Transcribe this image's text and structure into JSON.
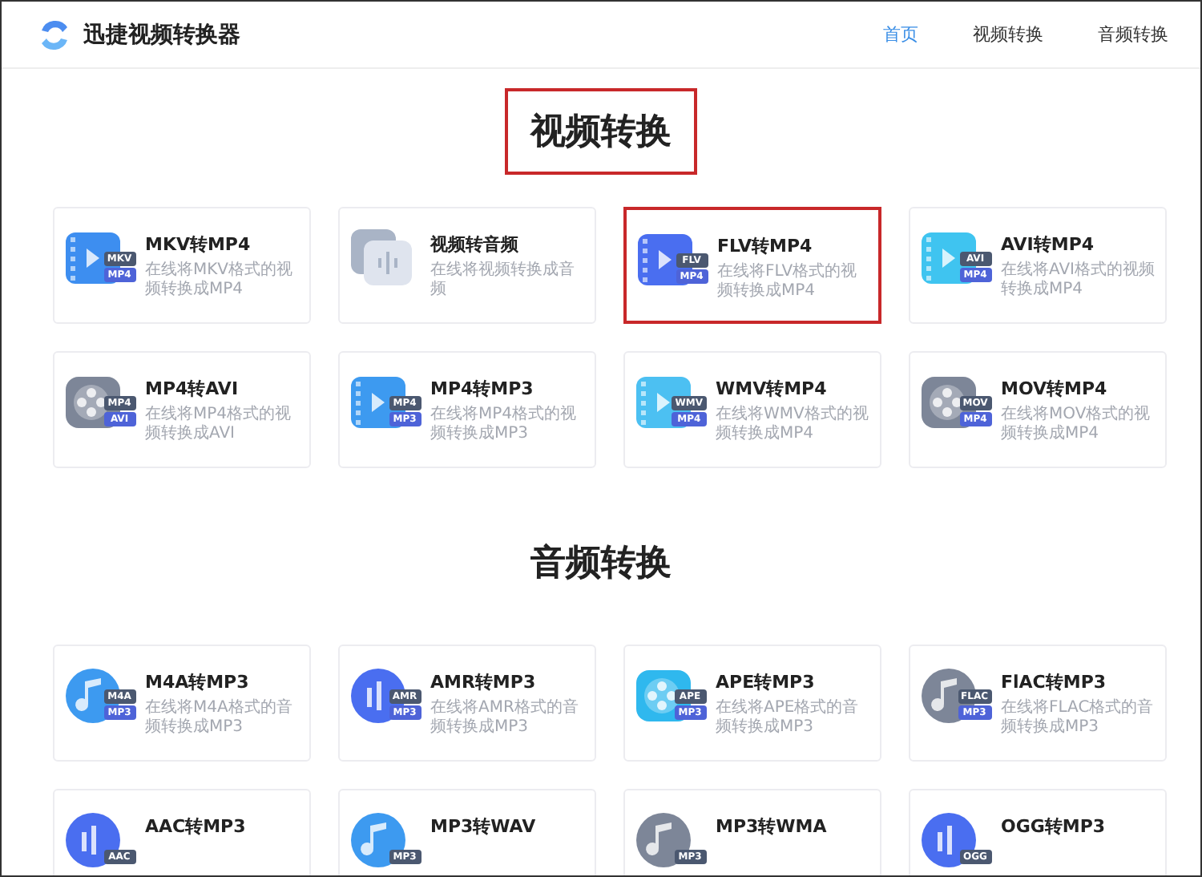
{
  "header": {
    "brand": "迅捷视频转换器",
    "nav": [
      {
        "label": "首页",
        "selected": true
      },
      {
        "label": "视频转换",
        "selected": false
      },
      {
        "label": "音频转换",
        "selected": false
      }
    ]
  },
  "sections": [
    {
      "title": "视频转换",
      "highlighted": true,
      "cards": [
        {
          "title": "MKV转MP4",
          "desc": "在线将MKV格式的视频转换成MP4",
          "highlighted": false,
          "icon": {
            "kind": "film",
            "color": "#3d8ef0",
            "badges": [
              "MKV",
              "MP4"
            ]
          }
        },
        {
          "title": "视频转音频",
          "desc": "在线将视频转换成音频",
          "highlighted": false,
          "icon": {
            "kind": "wave",
            "color": "#a9b4c6"
          }
        },
        {
          "title": "FLV转MP4",
          "desc": "在线将FLV格式的视频转换成MP4",
          "highlighted": true,
          "icon": {
            "kind": "film",
            "color": "#4a6ef0",
            "badges": [
              "FLV",
              "MP4"
            ]
          }
        },
        {
          "title": "AVI转MP4",
          "desc": "在线将AVI格式的视频转换成MP4",
          "highlighted": false,
          "icon": {
            "kind": "film",
            "color": "#3fc4f0",
            "badges": [
              "AVI",
              "MP4"
            ]
          }
        },
        {
          "title": "MP4转AVI",
          "desc": "在线将MP4格式的视频转换成AVI",
          "highlighted": false,
          "icon": {
            "kind": "reel",
            "color": "#7d8698",
            "badges": [
              "MP4",
              "AVI"
            ]
          }
        },
        {
          "title": "MP4转MP3",
          "desc": "在线将MP4格式的视频转换成MP3",
          "highlighted": false,
          "icon": {
            "kind": "film",
            "color": "#3d9af0",
            "badges": [
              "MP4",
              "MP3"
            ]
          }
        },
        {
          "title": "WMV转MP4",
          "desc": "在线将WMV格式的视频转换成MP4",
          "highlighted": false,
          "icon": {
            "kind": "film",
            "color": "#4cc0f2",
            "badges": [
              "WMV",
              "MP4"
            ]
          }
        },
        {
          "title": "MOV转MP4",
          "desc": "在线将MOV格式的视频转换成MP4",
          "highlighted": false,
          "icon": {
            "kind": "reel",
            "color": "#7d8698",
            "badges": [
              "MOV",
              "MP4"
            ]
          }
        }
      ]
    },
    {
      "title": "音频转换",
      "highlighted": false,
      "cards": [
        {
          "title": "M4A转MP3",
          "desc": "在线将M4A格式的音频转换成MP3",
          "highlighted": false,
          "icon": {
            "kind": "note",
            "color": "#3d9af0",
            "badges": [
              "M4A",
              "MP3"
            ]
          }
        },
        {
          "title": "AMR转MP3",
          "desc": "在线将AMR格式的音频转换成MP3",
          "highlighted": false,
          "icon": {
            "kind": "bars",
            "color": "#4a6ef0",
            "badges": [
              "AMR",
              "MP3"
            ]
          }
        },
        {
          "title": "APE转MP3",
          "desc": "在线将APE格式的音频转换成MP3",
          "highlighted": false,
          "icon": {
            "kind": "reel",
            "color": "#2fb8ee",
            "badges": [
              "APE",
              "MP3"
            ]
          }
        },
        {
          "title": "FlAC转MP3",
          "desc": "在线将FLAC格式的音频转换成MP3",
          "highlighted": false,
          "icon": {
            "kind": "note",
            "color": "#7d8698",
            "badges": [
              "FLAC",
              "MP3"
            ]
          }
        },
        {
          "title": "AAC转MP3",
          "highlighted": false,
          "icon": {
            "kind": "bars",
            "color": "#4a6ef0",
            "badges": [
              "AAC"
            ]
          }
        },
        {
          "title": "MP3转WAV",
          "highlighted": false,
          "icon": {
            "kind": "note",
            "color": "#3d9af0",
            "badges": [
              "MP3"
            ]
          }
        },
        {
          "title": "MP3转WMA",
          "highlighted": false,
          "icon": {
            "kind": "note",
            "color": "#7d8698",
            "badges": [
              "MP3"
            ]
          }
        },
        {
          "title": "OGG转MP3",
          "highlighted": false,
          "icon": {
            "kind": "bars",
            "color": "#4a6ef0",
            "badges": [
              "OGG"
            ]
          }
        }
      ]
    }
  ]
}
